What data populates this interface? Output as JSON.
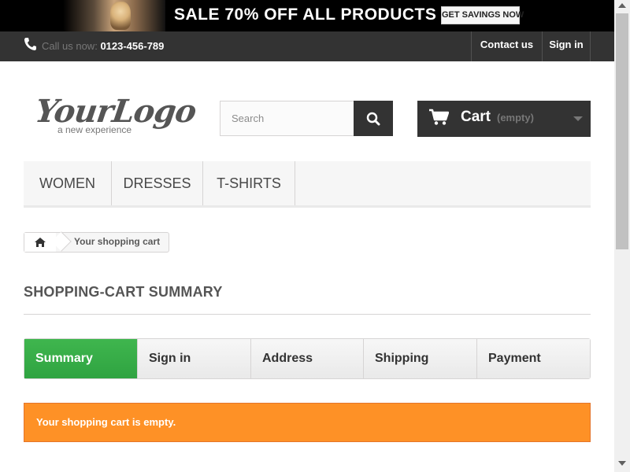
{
  "promo": {
    "text": "SALE 70% OFF ALL PRODUCTS",
    "button_label": "GET SAVINGS NOW"
  },
  "topbar": {
    "call_label": "Call us now:",
    "phone": "0123-456-789",
    "contact_label": "Contact us",
    "signin_label": "Sign in"
  },
  "logo": {
    "main": "YourLogo",
    "tagline": "a new experience"
  },
  "search": {
    "placeholder": "Search"
  },
  "cart": {
    "label": "Cart",
    "status": "(empty)"
  },
  "menu": {
    "items": [
      "WOMEN",
      "DRESSES",
      "T-SHIRTS"
    ]
  },
  "breadcrumb": {
    "current": "Your shopping cart"
  },
  "page": {
    "heading": "SHOPPING-CART SUMMARY"
  },
  "steps": [
    "Summary",
    "Sign in",
    "Address",
    "Shipping",
    "Payment"
  ],
  "alert": {
    "text": "Your shopping cart is empty."
  },
  "colors": {
    "accent_green": "#3fb64e",
    "alert_orange": "#fe9126",
    "dark": "#333333"
  },
  "icons": [
    "phone-icon",
    "search-icon",
    "cart-icon",
    "home-icon",
    "chevron-down-icon"
  ]
}
